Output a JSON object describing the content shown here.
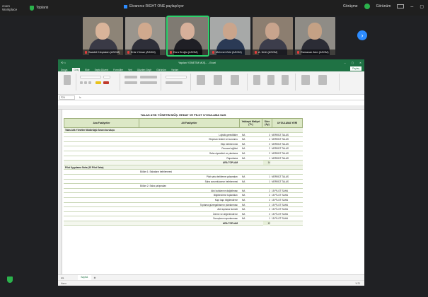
{
  "zoom": {
    "logo": "zoom\nWorkplace",
    "tb_label": "Toplantı",
    "window_title": "Ekranınız RIGHT ONE paylaşılıyor",
    "right_status": "Görüşme",
    "view_label": "Görünüm"
  },
  "participants": [
    {
      "name": "Saadet Kılıçaslan (ASGM)",
      "skin": "#d9b49a",
      "shirt": "#3a3a46",
      "bg": "#8d8477"
    },
    {
      "name": "Enis Yılmaz (ASGM)",
      "skin": "#d0a98e",
      "shirt": "#2e2f39",
      "bg": "#9a958d"
    },
    {
      "name": "Esra Eroğlu (ASGM)",
      "skin": "#d7b09a",
      "shirt": "#1f1f25",
      "bg": "#7f7a72"
    },
    {
      "name": "Mehmet Zeki (ASGM)",
      "skin": "#caa58c",
      "shirt": "#2b3a55",
      "bg": "#a7a9a8"
    },
    {
      "name": "A. Ünlü (ASGM)",
      "skin": "#c8a48d",
      "shirt": "#3c3d4b",
      "bg": "#8c7e70"
    },
    {
      "name": "Ramazan Akın (ASGM)",
      "skin": "#c4a185",
      "shirt": "#2b2c35",
      "bg": "#8f8c86"
    }
  ],
  "excel": {
    "file_title": "Yapılan YÖNETİM MÜŞ... - Excel",
    "menu": [
      "Dosya",
      "Giriş",
      "Ekle",
      "Sayfa Düzeni",
      "Formüller",
      "Veri",
      "Gözden Geçir",
      "Görünüm",
      "Yardım"
    ],
    "share": "Paylaş",
    "cell_ref": "F24",
    "sheet_title": "TALAS ATIK YÖNETİM MÜŞ. HEDAT VE PİLOT UYGULAMA SAS",
    "headers": {
      "col1": "Ana Faaliyetler",
      "col2": "Alt Faaliyetler",
      "col3": "Yaklaşık Maliyet (TL)",
      "col4": "Süre (Ay)",
      "col5": "UYGULAMA YERİ"
    },
    "rows": [
      {
        "kind": "sec",
        "c1": "Talas Atık Yönetim Müdürlüğü Sınavı kuruluşu",
        "c2": "",
        "c3": "",
        "c4": "",
        "c5": ""
      },
      {
        "kind": "row",
        "c1": "",
        "c2": "Lojistik gereklilikler",
        "c3": "NA",
        "c4": "3",
        "c5": "MERKEZ TALAS"
      },
      {
        "kind": "row",
        "c1": "",
        "c2": "Ekipman teslimi ve kurulumu",
        "c3": "NA",
        "c4": "4",
        "c5": "MERKEZ TALAS"
      },
      {
        "kind": "row",
        "c1": "",
        "c2": "Ekip belirlenmesi",
        "c3": "NA",
        "c4": "2",
        "c5": "MERKEZ TALAS"
      },
      {
        "kind": "row",
        "c1": "",
        "c2": "Personel eğitimi",
        "c3": "NA",
        "c4": "2",
        "c5": "MERKEZ TALAS"
      },
      {
        "kind": "row",
        "c1": "",
        "c2": "Saha ziyaretleri ve planlama",
        "c3": "NA",
        "c4": "2",
        "c5": "MERKEZ TALAS"
      },
      {
        "kind": "row",
        "c1": "",
        "c2": "Raporlama",
        "c3": "NA",
        "c4": "1",
        "c5": "MERKEZ TALAS"
      },
      {
        "kind": "tot",
        "c1": "",
        "c2": "ARA TOPLAM",
        "c3": "",
        "c4": "14",
        "c5": ""
      },
      {
        "kind": "sec",
        "c1": "Pilot Uygulama Saha (15 Pilot Saha)",
        "c2": "",
        "c3": "",
        "c4": "",
        "c5": ""
      },
      {
        "kind": "row",
        "c1": "",
        "c2": "Bölüm 1: Sahaların belirlenmesi",
        "c3": "",
        "c4": "",
        "c5": "",
        "left": true
      },
      {
        "kind": "row",
        "c1": "",
        "c2": "Pilot saha belirleme çalışmaları",
        "c3": "NA",
        "c4": "1",
        "c5": "MERKEZ TALAS"
      },
      {
        "kind": "row",
        "c1": "",
        "c2": "Saha sorumlularının belirlenmesi",
        "c3": "NA",
        "c4": "1",
        "c5": "MERKEZ TALAS"
      },
      {
        "kind": "row",
        "c1": "",
        "c2": "Bölüm 2: Saha çalışmaları",
        "c3": "",
        "c4": "",
        "c5": "",
        "left": true
      },
      {
        "kind": "row",
        "c1": "",
        "c2": "Atık kutularının dağıtılması",
        "c3": "NA",
        "c4": "2",
        "c5": "15 PİLOT SAHA"
      },
      {
        "kind": "row",
        "c1": "",
        "c2": "Bilgilendirme toplantıları",
        "c3": "NA",
        "c4": "2",
        "c5": "15 PİLOT SAHA"
      },
      {
        "kind": "row",
        "c1": "",
        "c2": "Kapı kapı bilgilendirme",
        "c3": "NA",
        "c4": "2",
        "c5": "15 PİLOT SAHA"
      },
      {
        "kind": "row",
        "c1": "",
        "c2": "Toplama güzergahlarının planlanması",
        "c3": "NA",
        "c4": "2",
        "c5": "15 PİLOT SAHA"
      },
      {
        "kind": "row",
        "c1": "",
        "c2": "Atık toplama hizmeti",
        "c3": "NA",
        "c4": "2",
        "c5": "15 PİLOT SAHA"
      },
      {
        "kind": "row",
        "c1": "",
        "c2": "İzleme ve değerlendirme",
        "c3": "NA",
        "c4": "2",
        "c5": "15 PİLOT SAHA"
      },
      {
        "kind": "row",
        "c1": "",
        "c2": "Sonuçların raporlanması",
        "c3": "NA",
        "c4": "1",
        "c5": "15 PİLOT SAHA"
      },
      {
        "kind": "tot",
        "c1": "",
        "c2": "ARA TOPLAM",
        "c3": "",
        "c4": "12",
        "c5": ""
      }
    ],
    "tab_label": "Sayfa1",
    "status": "Hazır",
    "zoom_level": "%70"
  }
}
